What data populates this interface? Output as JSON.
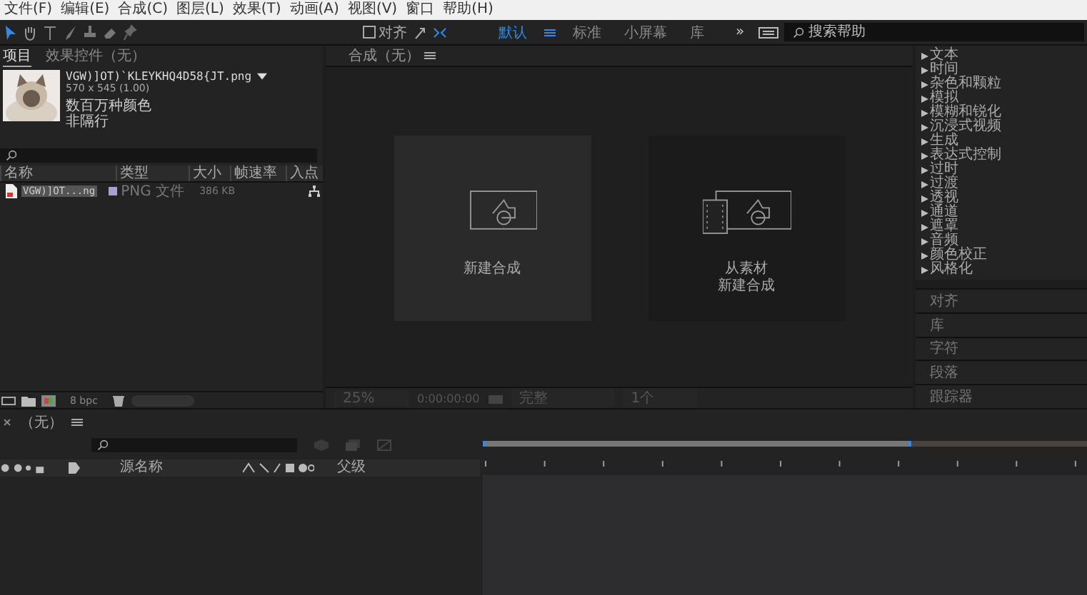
{
  "menu": [
    {
      "label": "文件(F)"
    },
    {
      "label": "编辑(E)"
    },
    {
      "label": "合成(C)"
    },
    {
      "label": "图层(L)"
    },
    {
      "label": "效果(T)"
    },
    {
      "label": "动画(A)"
    },
    {
      "label": "视图(V)"
    },
    {
      "label": "窗口"
    },
    {
      "label": "帮助(H)"
    }
  ],
  "toolbar": {
    "snap": {
      "label": "对齐",
      "checked": false
    },
    "workspaces": [
      {
        "label": "默认",
        "selected": true
      },
      {
        "label": "标准",
        "selected": false
      },
      {
        "label": "小屏幕",
        "selected": false
      },
      {
        "label": "库",
        "selected": false
      }
    ],
    "more": "»",
    "search": {
      "placeholder": "搜索帮助"
    }
  },
  "project": {
    "tabs": [
      {
        "label": "项目",
        "selected": true
      },
      {
        "label": "效果控件（无）",
        "selected": false
      }
    ],
    "file": {
      "name": "VGW)]OT)`KLEYKHQ4D58{JT.png",
      "dimensions": "570 x 545 (1.00)",
      "colors": "数百万种颜色",
      "interlace": "非隔行"
    },
    "columns": [
      "名称",
      "类型",
      "大小",
      "帧速率",
      "入点"
    ],
    "rows": [
      {
        "name": "VGW)]OT...ng",
        "type": "PNG 文件",
        "size": "386 KB",
        "selected": true
      }
    ],
    "bpc": "8 bpc"
  },
  "composition": {
    "tab": "合成（无）",
    "actions": [
      {
        "lines": [
          "新建合成"
        ],
        "kind": "new",
        "hovered": true
      },
      {
        "lines": [
          "从素材",
          "新建合成"
        ],
        "kind": "footage",
        "hovered": false
      }
    ],
    "zoom": "25%",
    "timecode": "0:00:00:00",
    "resolution": "完整",
    "views": "1个"
  },
  "effects": {
    "categories": [
      "文本",
      "时间",
      "杂色和颗粒",
      "模拟",
      "模糊和锐化",
      "沉浸式视频",
      "生成",
      "表达式控制",
      "过时",
      "过渡",
      "透视",
      "通道",
      "遮罩",
      "音频",
      "颜色校正",
      "风格化"
    ]
  },
  "panels": [
    "对齐",
    "库",
    "字符",
    "段落",
    "跟踪器"
  ],
  "timeline": {
    "tab": "（无）",
    "columns": [
      "源名称",
      "父级"
    ],
    "work_area": {
      "level": 0.71
    }
  }
}
